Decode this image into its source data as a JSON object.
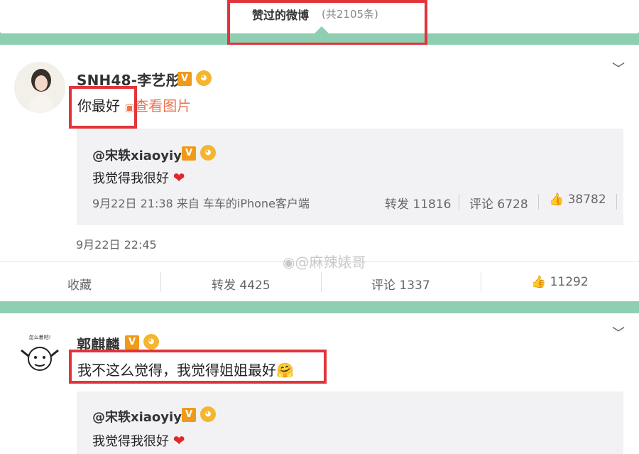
{
  "header": {
    "title": "赞过的微博",
    "count": "(共2105条)"
  },
  "posts": [
    {
      "user": "SNH48-李艺彤",
      "text": "你最好",
      "view_image": "查看图片",
      "repost": {
        "user": "@宋轶xiaoyiyi",
        "text": "我觉得我很好",
        "meta": "9月22日 21:38 来自 车车的iPhone客户端",
        "forward": "转发 11816",
        "comment": "评论 6728",
        "like": "38782"
      },
      "timestamp": "9月22日 22:45",
      "actions": {
        "favorite": "收藏",
        "forward": "转发 4425",
        "comment": "评论 1337",
        "like": "11292"
      }
    },
    {
      "user": "郭麒麟",
      "text": "我不这么觉得，我觉得姐姐最好",
      "avatar_caption": "怎么着吧!",
      "repost": {
        "user": "@宋轶xiaoyiyi",
        "text": "我觉得我很好"
      }
    }
  ],
  "watermark": "@麻辣婊哥",
  "colors": {
    "accent_orange": "#eb7350",
    "highlight_red": "#e1343b",
    "background": "#8fcfb1"
  }
}
